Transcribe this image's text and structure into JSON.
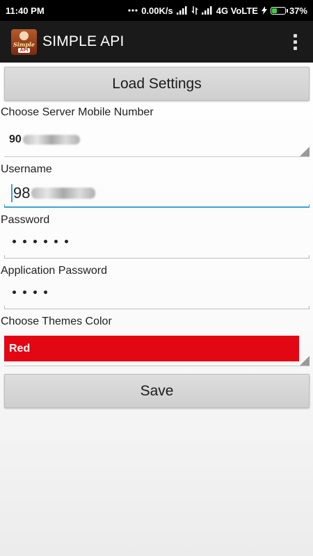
{
  "status_bar": {
    "time": "11:40 PM",
    "network_speed": "0.00K/s",
    "network_type": "4G VoLTE",
    "battery": "37%",
    "battery_level": 0.37
  },
  "app_bar": {
    "title": "SIMPLE API",
    "logo_line1": "Simple",
    "logo_line2": "API"
  },
  "buttons": {
    "load": "Load Settings",
    "save": "Save"
  },
  "form": {
    "server_label": "Choose Server Mobile Number",
    "server_value_visible": "90",
    "username_label": "Username",
    "username_value_visible": "98",
    "password_label": "Password",
    "password_dot_count": 6,
    "app_password_label": "Application Password",
    "app_password_dot_count": 4,
    "theme_label": "Choose Themes Color",
    "theme_value": "Red"
  },
  "colors": {
    "theme_red": "#e30613",
    "focus_blue": "#3ea0d8"
  }
}
